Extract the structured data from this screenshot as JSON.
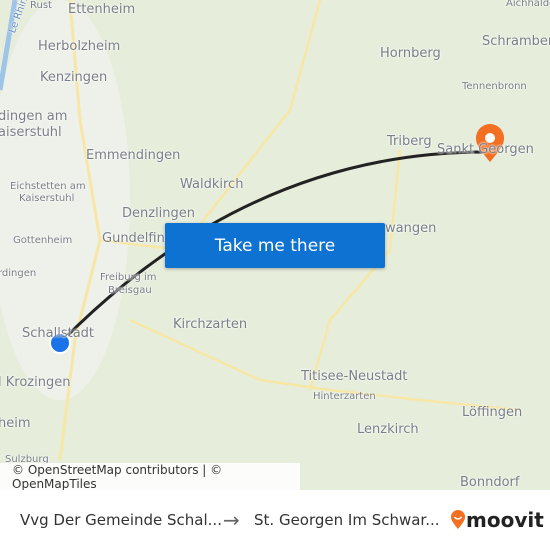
{
  "map": {
    "labels": [
      "Rust",
      "Ettenheim",
      "Herbolzheim",
      "Kenzingen",
      "dingen am",
      "aiserstuhl",
      "Emmendingen",
      "Eichstetten am",
      "Kaiserstuhl",
      "Waldkirch",
      "Denzlingen",
      "Gundelfingen",
      "Gottenheim",
      "Freiburg im",
      "Breisgau",
      "rdingen",
      "Schallstadt",
      "Kirchzarten",
      "l Krozingen",
      "heim",
      "Sulzburg",
      "Hornberg",
      "Schramberg",
      "Tennenbronn",
      "Triberg",
      "Sankt Georgen",
      "Aichhalde",
      "wangen",
      "Titisee-Neustadt",
      "Hinterzarten",
      "Löffingen",
      "Lenzkirch",
      "Bonndorf",
      "Le Rhin"
    ],
    "attribution": "© OpenStreetMap contributors | © OpenMapTiles",
    "route_color": "#222222",
    "origin_marker_color": "#1a73e8",
    "destination_marker_color": "#f36f21"
  },
  "cta": {
    "label": "Take me there"
  },
  "footer": {
    "from": "Vvg Der Gemeinde Schal...",
    "arrow": "→",
    "to": "St. Georgen Im Schwar...",
    "brand": "moovit"
  }
}
